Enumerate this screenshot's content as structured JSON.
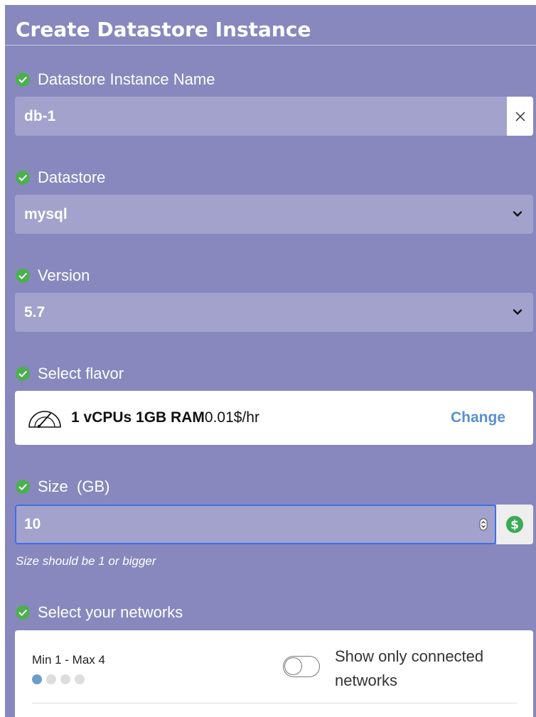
{
  "form": {
    "title": "Create Datastore Instance",
    "name_section": {
      "label": "Datastore Instance Name",
      "value": "db-1",
      "clear_glyph": "×"
    },
    "datastore_section": {
      "label": "Datastore",
      "value": "mysql"
    },
    "version_section": {
      "label": "Version",
      "value": "5.7"
    },
    "flavor_section": {
      "label": "Select flavor",
      "spec_bold": "1 vCPUs 1GB RAM",
      "price": "0.01$/hr",
      "change_label": "Change"
    },
    "size_section": {
      "label": "Size  (GB)",
      "value": "10",
      "hint": "Size should be 1 or bigger"
    },
    "networks_section": {
      "label": "Select your networks",
      "limits": "Min 1 - Max 4",
      "selected_dot": 1,
      "total_dots": 4,
      "toggle_label": "Show only connected networks",
      "toggle_on": false
    }
  },
  "colors": {
    "panel": "#8888bf",
    "field": "#a2a2cd",
    "check": "#4caf50",
    "accent_link": "#5a8fd0",
    "focus_border": "#3f6fe8",
    "price_icon": "#3aaa55"
  },
  "icons": {
    "check": "check-circle-icon",
    "clear": "close-icon",
    "dropdown": "chevron-down-icon",
    "flavor": "speedometer-icon",
    "stepper": "spinner-arrows-icon",
    "price": "dollar-circle-icon"
  }
}
